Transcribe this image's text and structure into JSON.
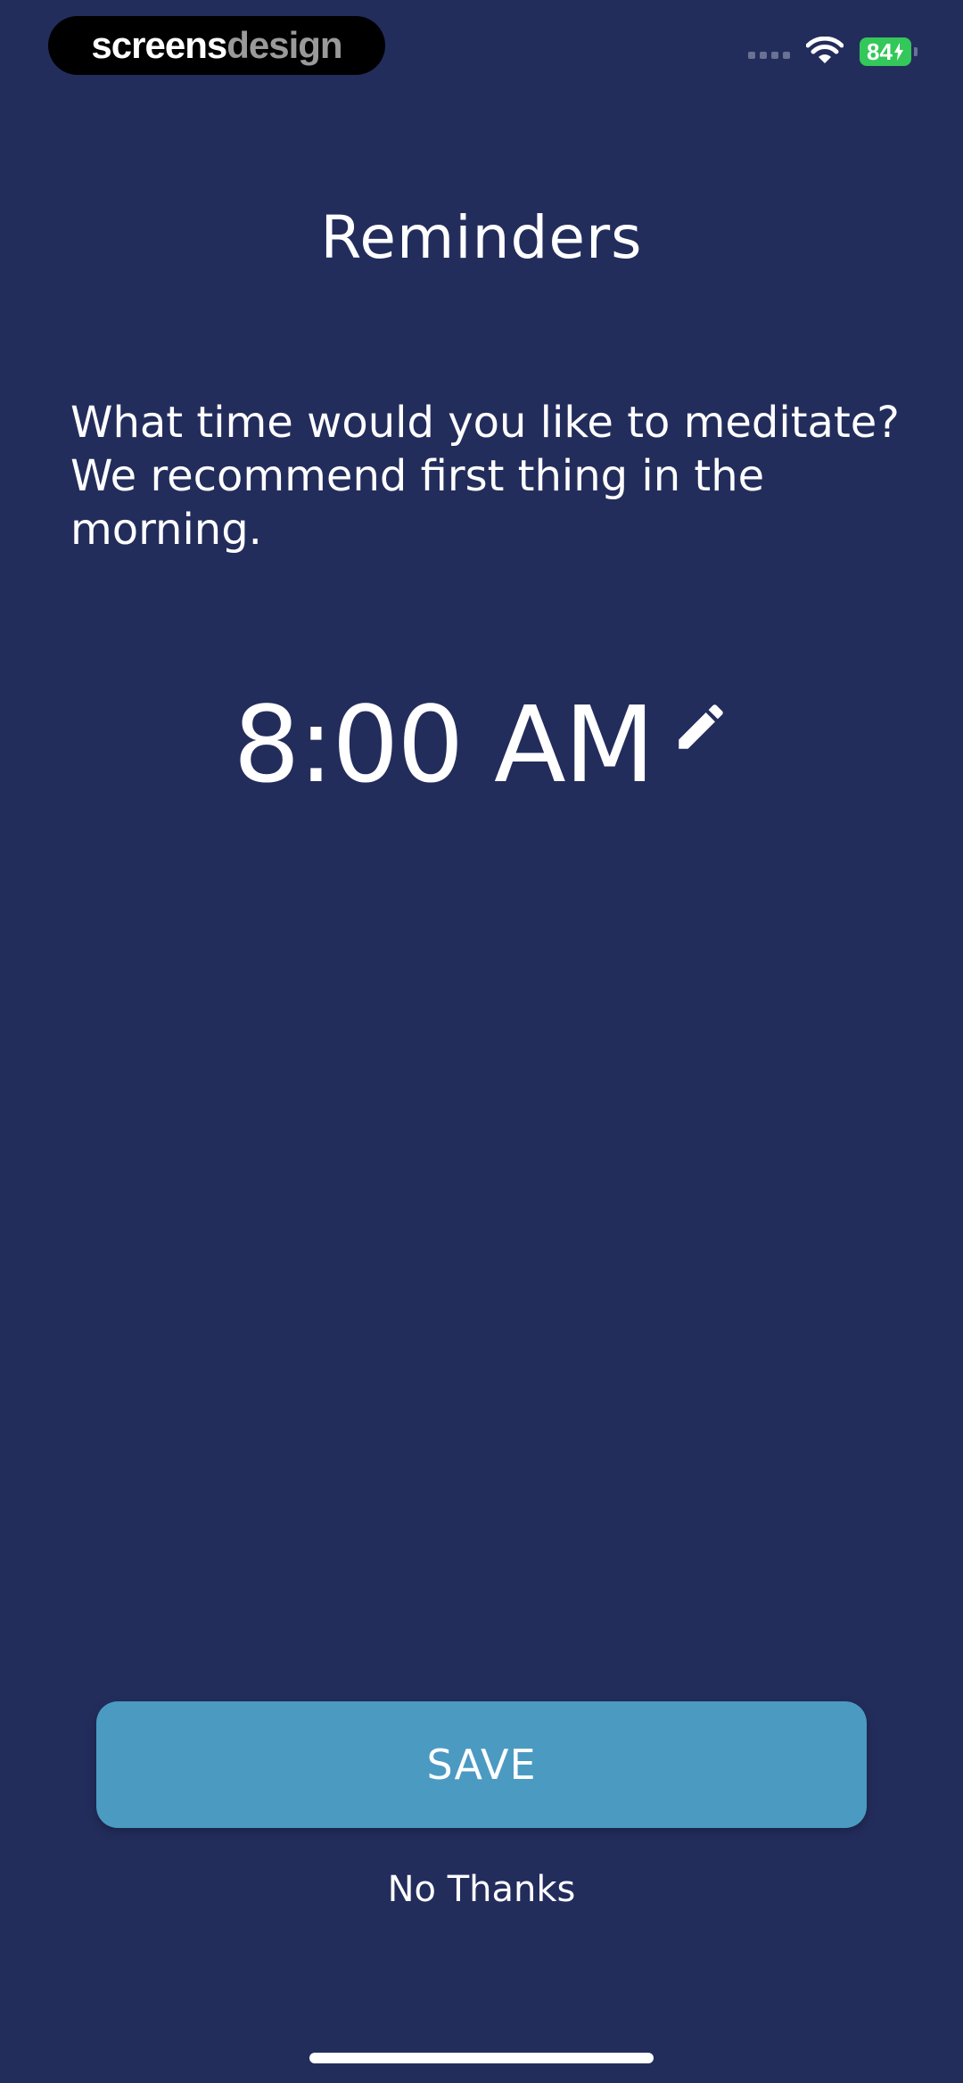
{
  "watermark": {
    "part1": "screens",
    "part2": "design"
  },
  "status_bar": {
    "signal_icon": "signal-dots-icon",
    "wifi_icon": "wifi-icon",
    "battery_level": "84",
    "battery_icon": "battery-charging-icon"
  },
  "header": {
    "title": "Reminders"
  },
  "prompt": {
    "text": "What time would you like to meditate? We recommend first thing in the morning."
  },
  "reminder": {
    "time": "8:00 AM",
    "edit_icon": "pencil-icon"
  },
  "actions": {
    "save_label": "SAVE",
    "dismiss_label": "No Thanks"
  },
  "colors": {
    "background": "#232d5c",
    "button": "#4b9ac2",
    "text": "#ffffff",
    "battery": "#34c759"
  }
}
